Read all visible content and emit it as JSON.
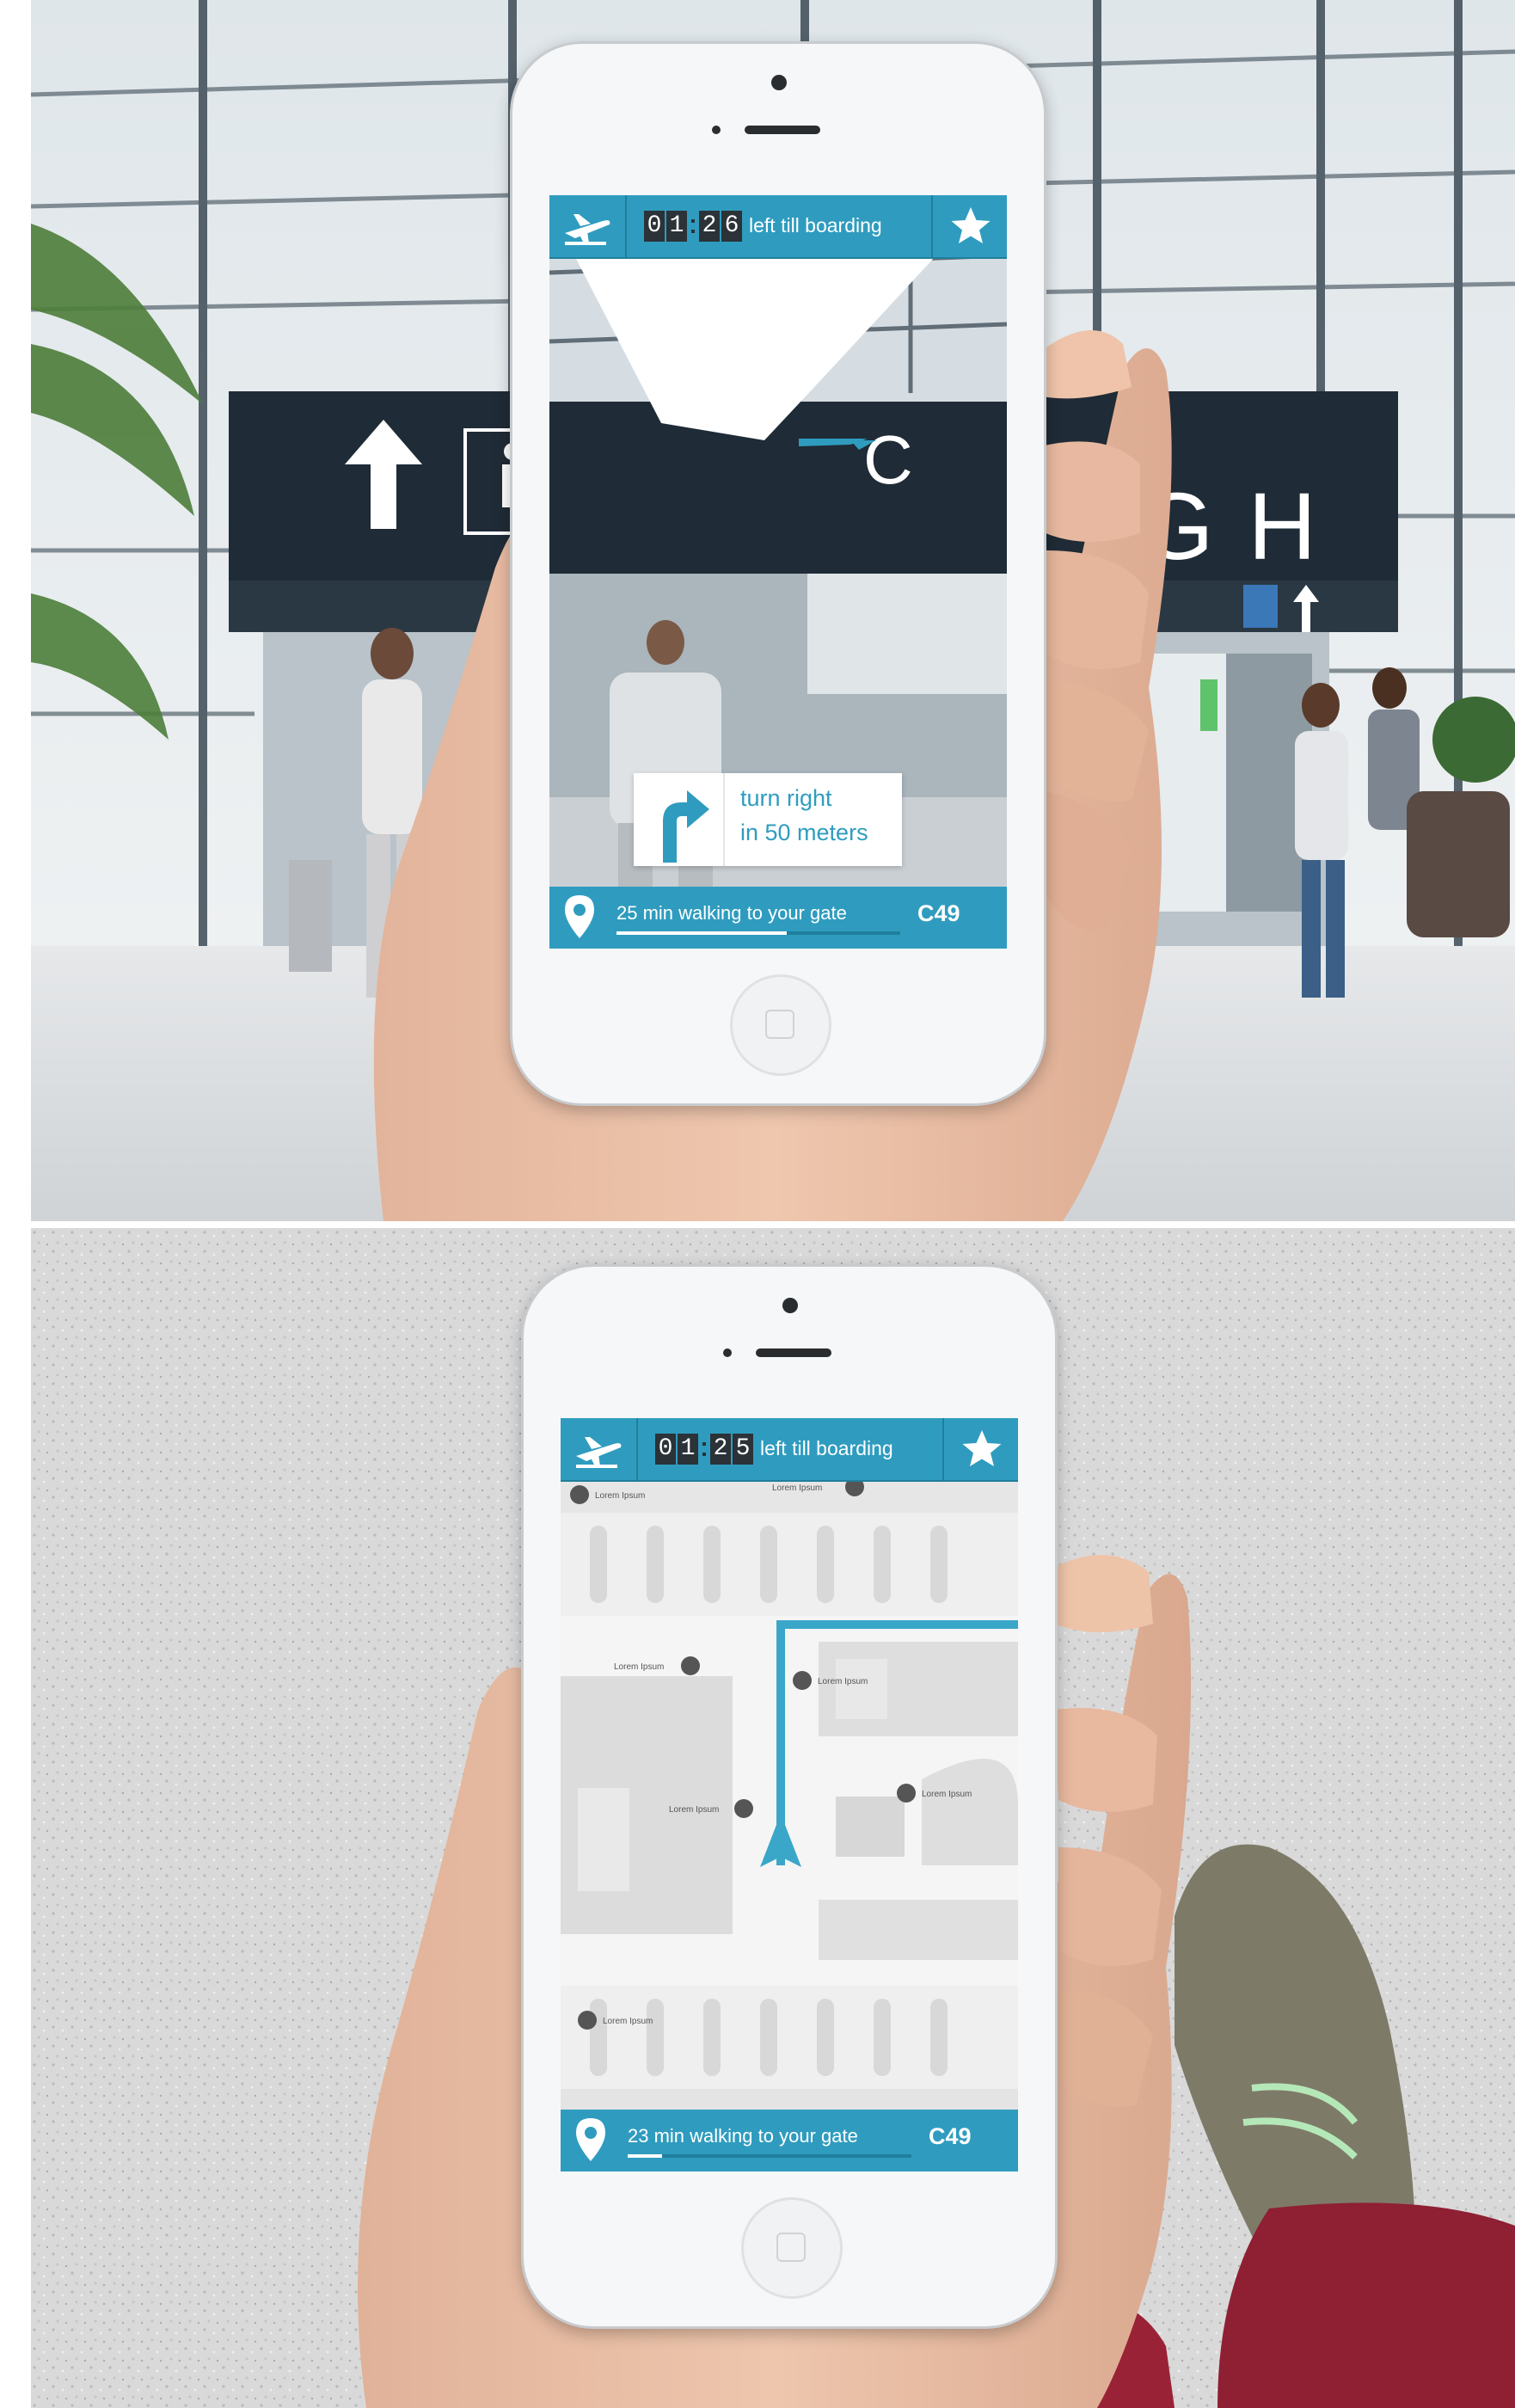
{
  "colors": {
    "accent": "#2f9cbf",
    "accent_dark": "#1f7f9c",
    "route": "#3aa6c8",
    "pin": "#555555"
  },
  "screens": [
    {
      "header": {
        "plane_icon": "plane-icon",
        "counter_digits": [
          "0",
          "1",
          "2",
          "6"
        ],
        "boarding_label": "left till boarding",
        "star_icon": "star-icon"
      },
      "ar_view": {
        "sign_letters": "C",
        "sign_letters_right": "GH",
        "direction": {
          "line1": "turn right",
          "line2": "in 50 meters",
          "icon": "turn-right-arrow-icon"
        }
      },
      "footer": {
        "pin_icon": "location-pin-icon",
        "walking_text": "25 min walking to your gate",
        "gate": "C49",
        "progress": 0.6
      }
    },
    {
      "header": {
        "plane_icon": "plane-icon",
        "counter_digits": [
          "0",
          "1",
          "2",
          "5"
        ],
        "boarding_label": "left till boarding",
        "star_icon": "star-icon"
      },
      "map": {
        "poi_labels": [
          "Lorem Ipsum",
          "Lorem Ipsum",
          "Lorem Ipsum",
          "Lorem Ipsum",
          "Lorem Ipsum",
          "Lorem Ipsum",
          "Lorem Ipsum"
        ]
      },
      "footer": {
        "pin_icon": "location-pin-icon",
        "walking_text": "23 min walking to your gate",
        "gate": "C49",
        "progress": 0.12
      }
    }
  ]
}
